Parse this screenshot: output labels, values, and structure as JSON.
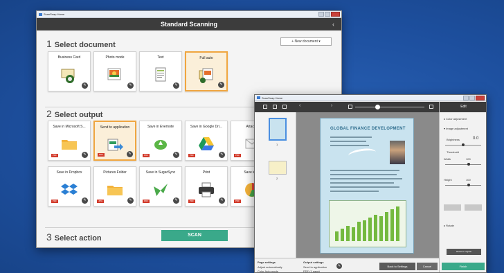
{
  "colors": {
    "accent": "#3aa98a",
    "selected_border": "#f0a640",
    "badge": "#d23a2a",
    "header": "#3c3c3c"
  },
  "window1": {
    "title": "ScanSnap Home",
    "header": "Standard Scanning",
    "section1": {
      "num": "1",
      "title": "Select document",
      "new_document": "New document"
    },
    "documents": [
      {
        "label": "Business Card",
        "icon": "business-card-icon"
      },
      {
        "label": "Photo mode",
        "icon": "photo-icon"
      },
      {
        "label": "Text",
        "icon": "text-document-icon"
      },
      {
        "label": "Full auto",
        "icon": "full-auto-icon",
        "selected": true
      }
    ],
    "section2": {
      "num": "2",
      "title": "Select output"
    },
    "outputs_row1": [
      {
        "label": "Save in Microsoft S...",
        "icon": "folder-icon",
        "badge": "PDF"
      },
      {
        "label": "Send to application",
        "icon": "send-to-app-icon",
        "badge": "PDF",
        "selected": true
      },
      {
        "label": "Save in Evernote",
        "icon": "evernote-icon",
        "badge": "PDF"
      },
      {
        "label": "Save in Google Dri...",
        "icon": "google-drive-icon",
        "badge": "PDF"
      },
      {
        "label": "Attach t",
        "icon": "attach-icon",
        "badge": "PDF"
      }
    ],
    "outputs_row2": [
      {
        "label": "Save in Dropbox",
        "icon": "dropbox-icon",
        "badge": "PDF"
      },
      {
        "label": "Pictures Folder",
        "icon": "folder-icon",
        "badge": "JPG"
      },
      {
        "label": "Save in SugarSync",
        "icon": "sugarsync-icon",
        "badge": "PDF"
      },
      {
        "label": "Print",
        "icon": "printer-icon",
        "badge": "PDF"
      },
      {
        "label": "Save in Mi",
        "icon": "chart-icon",
        "badge": "PDF"
      }
    ],
    "section3": {
      "num": "3",
      "title": "Select action"
    },
    "scan_label": "SCAN"
  },
  "window2": {
    "title": "ScanSnap Home",
    "edit_header": "Edit",
    "edit": {
      "color_adjustment": "Color adjustment",
      "image_adjustment": "Image adjustment",
      "brightness_label": "Brightness",
      "brightness_value": "0.0",
      "threshold_label": "Threshold",
      "width_label": "Width",
      "width_value": "100",
      "height_label": "Height",
      "height_value": "100",
      "rotate_label": "Rotate",
      "reset_label": "Reset to original"
    },
    "document_title": "GLOBAL FINANCE DEVELOPMENT",
    "thumb1_label": "1",
    "thumb2_label": "2",
    "bottom": {
      "page_settings": "Page settings",
      "page_value1": "Adjust automatically",
      "page_value2": "Color Auto mode",
      "output_settings": "Output settings",
      "output_value1": "Send to application",
      "output_value2": "PDF (1 page)",
      "btn_back": "Back to Settings",
      "btn_cancel": "Cancel",
      "btn_finish": "Finish"
    }
  }
}
